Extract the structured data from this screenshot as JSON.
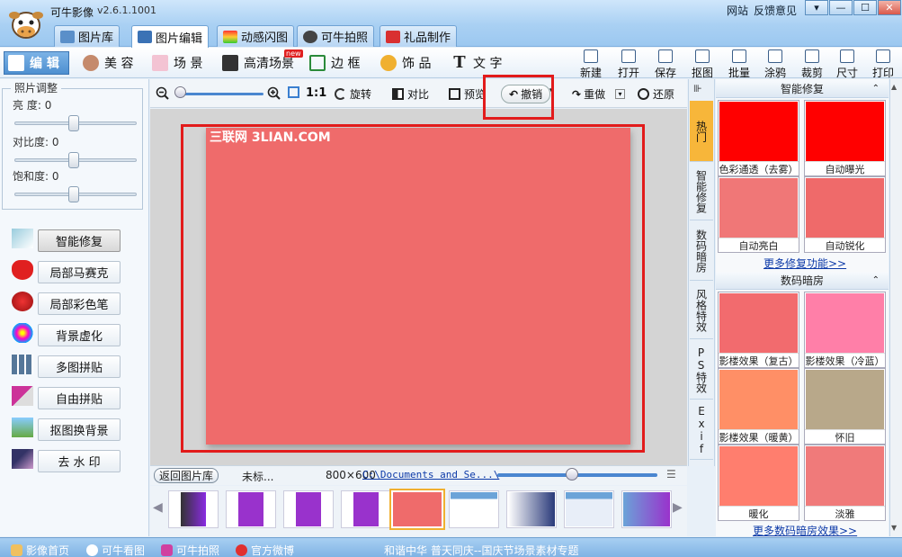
{
  "app": {
    "title": "可牛影像",
    "version": "v2.6.1.1001",
    "links": [
      "网站",
      "反馈意见"
    ]
  },
  "window_buttons": [
    "▾",
    "—",
    "☐",
    "✕"
  ],
  "main_tabs": [
    {
      "label": "图片库"
    },
    {
      "label": "图片编辑",
      "active": true
    },
    {
      "label": "动感闪图"
    },
    {
      "label": "可牛拍照"
    },
    {
      "label": "礼品制作"
    }
  ],
  "edit_tools": [
    {
      "label": "编 辑",
      "active": true
    },
    {
      "label": "美 容"
    },
    {
      "label": "场 景"
    },
    {
      "label": "高清场景",
      "badge": "new"
    },
    {
      "label": "边 框"
    },
    {
      "label": "饰 品"
    },
    {
      "label": "文 字"
    }
  ],
  "file_tools": [
    "新建",
    "打开",
    "保存",
    "抠图",
    "批量",
    "涂鸦",
    "裁剪",
    "尺寸",
    "打印"
  ],
  "photo_adjust": {
    "title": "照片调整",
    "sliders": [
      {
        "label": "亮  度:",
        "value": "0"
      },
      {
        "label": "对比度:",
        "value": "0"
      },
      {
        "label": "饱和度:",
        "value": "0"
      }
    ]
  },
  "functions": [
    {
      "label": "智能修复",
      "active": true
    },
    {
      "label": "局部马赛克"
    },
    {
      "label": "局部彩色笔"
    },
    {
      "label": "背景虚化"
    },
    {
      "label": "多图拼贴"
    },
    {
      "label": "自由拼贴"
    },
    {
      "label": "抠图换背景"
    },
    {
      "label": "去 水 印"
    }
  ],
  "canvas_toolbar": {
    "ratio": "1:1",
    "rotate": "旋转",
    "compare": "对比",
    "preview": "预览",
    "undo": "撤销",
    "redo": "重做",
    "restore": "还原"
  },
  "image": {
    "watermark": "三联网 3LIAN.COM",
    "color": "#ef6b6b"
  },
  "status": {
    "back": "返回图片库",
    "name": "未标...",
    "size": "800×600",
    "path": "C:\\Documents and Se...\\"
  },
  "vtabs": [
    {
      "label": "热门",
      "active": true
    },
    {
      "label": "智能修复"
    },
    {
      "label": "数码暗房"
    },
    {
      "label": "风格特效"
    },
    {
      "label": "PS特效"
    },
    {
      "label": "Exif"
    }
  ],
  "sections": [
    {
      "title": "智能修复",
      "more": "更多修复功能>>",
      "effects": [
        {
          "label": "色彩通透（去雾）",
          "color": "#ff0000"
        },
        {
          "label": "自动曝光",
          "color": "#ff0000"
        },
        {
          "label": "自动亮白",
          "color": "#f07777"
        },
        {
          "label": "自动锐化",
          "color": "#ef6a6a"
        }
      ]
    },
    {
      "title": "数码暗房",
      "more": "更多数码暗房效果>>",
      "effects": [
        {
          "label": "影楼效果（复古）",
          "color": "#f26b6e"
        },
        {
          "label": "影楼效果（冷蓝）",
          "color": "#ff7fa8"
        },
        {
          "label": "影楼效果（暖黄）",
          "color": "#ff8f66"
        },
        {
          "label": "怀旧",
          "color": "#b8a88a"
        },
        {
          "label": "暖化",
          "color": "#ff7e6e"
        },
        {
          "label": "淡雅",
          "color": "#f07a7a"
        }
      ]
    }
  ],
  "bottom": {
    "items": [
      "影像首页",
      "可牛看图",
      "可牛拍照",
      "官方微博"
    ],
    "notice": "和谐中华  普天同庆--国庆节场景素材专题"
  }
}
